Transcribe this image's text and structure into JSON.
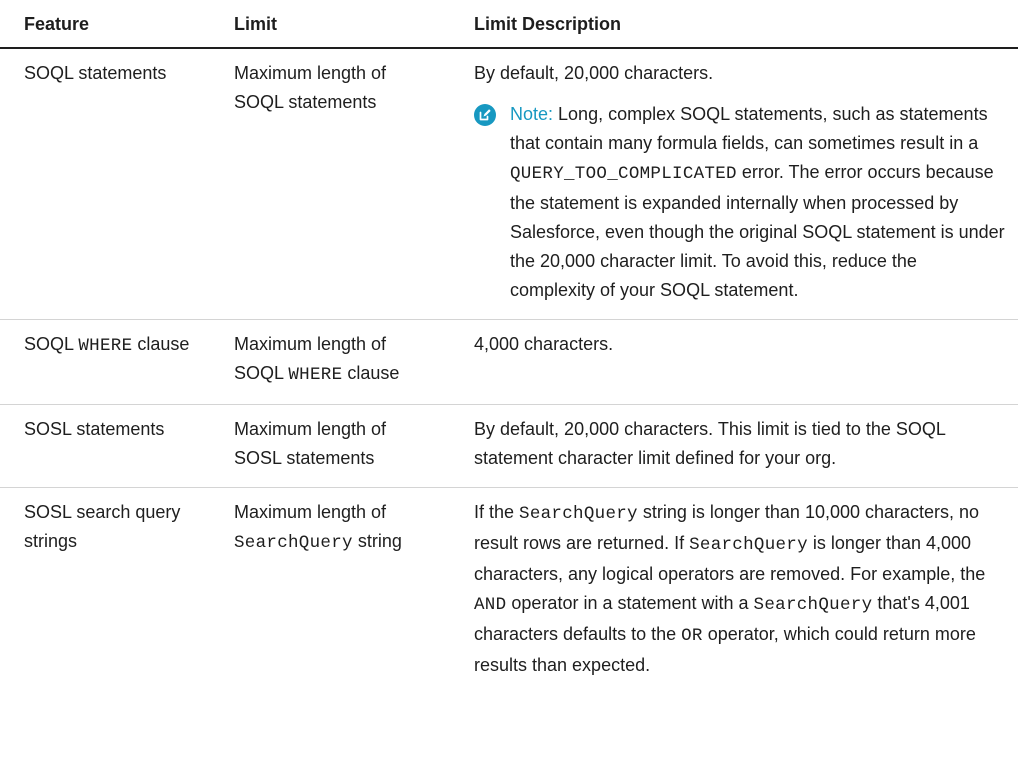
{
  "headers": {
    "feature": "Feature",
    "limit": "Limit",
    "description": "Limit Description"
  },
  "rows": [
    {
      "feature": [
        "SOQL statements"
      ],
      "limit": [
        "Maximum length of SOQL statements"
      ],
      "description": [
        "By default, 20,000 characters."
      ],
      "note": {
        "label": "Note:",
        "icon": "edit-note-icon",
        "parts": [
          " Long, complex SOQL statements, such as statements that contain many formula fields, can sometimes result in a ",
          {
            "code": "QUERY_TOO_COMPLICATED"
          },
          " error. The error occurs because the statement is expanded internally when processed by Salesforce, even though the original SOQL statement is under the 20,000 character limit. To avoid this, reduce the complexity of your SOQL statement."
        ]
      }
    },
    {
      "feature": [
        "SOQL ",
        {
          "code": "WHERE"
        },
        " clause"
      ],
      "limit": [
        "Maximum length of SOQL ",
        {
          "code": "WHERE"
        },
        " clause"
      ],
      "description": [
        "4,000 characters."
      ]
    },
    {
      "feature": [
        "SOSL statements"
      ],
      "limit": [
        "Maximum length of SOSL statements"
      ],
      "description": [
        "By default, 20,000 characters. This limit is tied to the SOQL statement character limit defined for your org."
      ]
    },
    {
      "feature": [
        "SOSL search query strings"
      ],
      "limit": [
        "Maximum length of ",
        {
          "code": "SearchQuery"
        },
        " string"
      ],
      "description": [
        "If the ",
        {
          "code": "SearchQuery"
        },
        " string is longer than 10,000 characters, no result rows are returned. If ",
        {
          "code": "SearchQuery"
        },
        " is longer than 4,000 characters, any logical operators are removed. For example, the ",
        {
          "code": "AND"
        },
        " operator in a statement with a ",
        {
          "code": "SearchQuery"
        },
        " that's 4,001 characters defaults to the ",
        {
          "code": "OR"
        },
        " operator, which could return more results than expected."
      ]
    }
  ],
  "colors": {
    "accent": "#1798c1",
    "rule": "#d4d4d4",
    "text": "#1e1e1e"
  }
}
